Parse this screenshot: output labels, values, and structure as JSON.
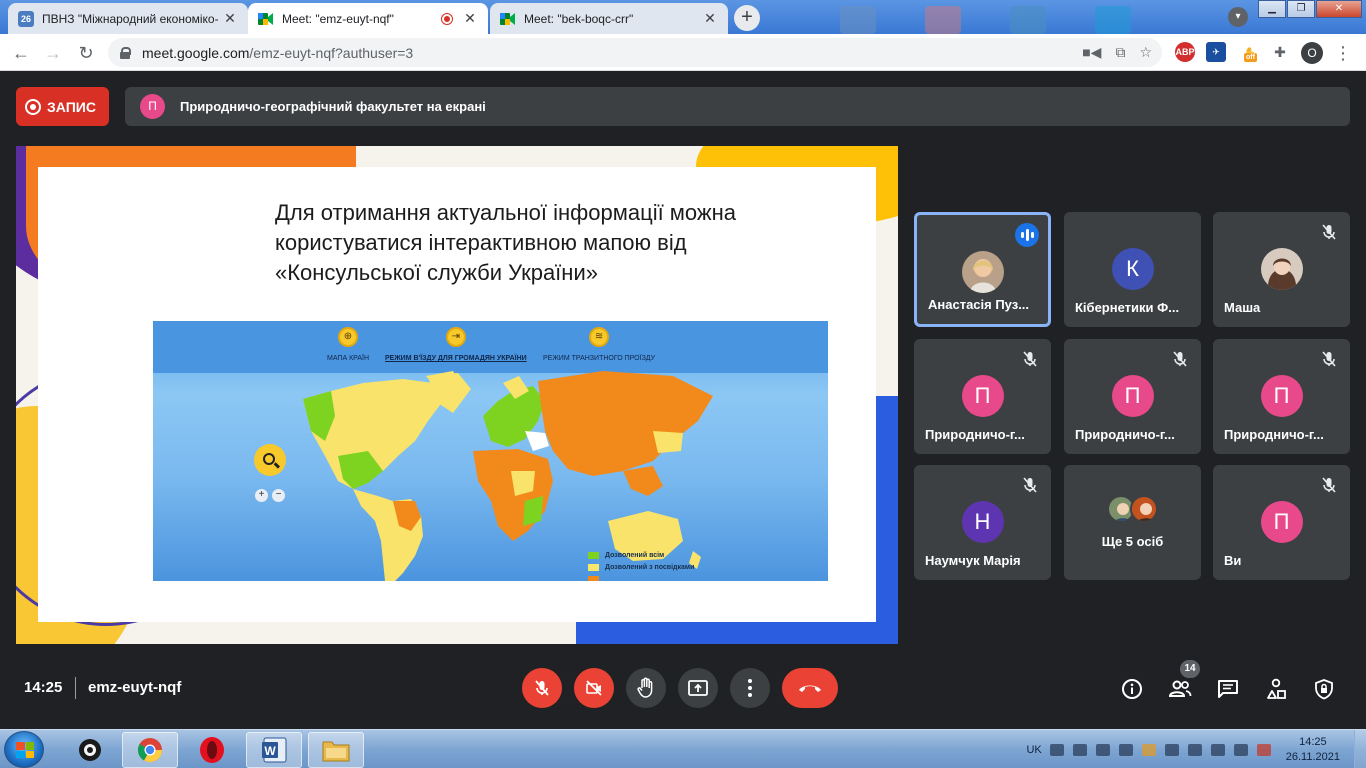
{
  "browser": {
    "tabs": [
      {
        "favicon_text": "26",
        "title": "ПВНЗ \"Міжнародний економіко-",
        "active": false
      },
      {
        "title": "Meet: \"emz-euyt-nqf\"",
        "active": true,
        "recording": true
      },
      {
        "title": "Meet: \"bek-boqc-crr\"",
        "active": false
      }
    ],
    "url_host": "meet.google.com",
    "url_path": "/emz-euyt-nqf?authuser=3",
    "extensions": {
      "abp": "ABP",
      "off_badge": "off"
    },
    "profile_initial": "O"
  },
  "meet": {
    "record_label": "ЗАПИС",
    "presenter_initial": "П",
    "presenting_text": "Природничо-географічний факультет на екрані",
    "slide": {
      "text": "Для отримання актуальної інформації можна користуватися інтерактивною мапою від «Консульської служби України»",
      "map": {
        "modes": [
          "МАПА КРАЇН",
          "РЕЖИМ В'ЇЗДУ ДЛЯ ГРОМАДЯН УКРАЇНИ",
          "РЕЖИМ ТРАНЗИТНОГО ПРОЇЗДУ"
        ],
        "legend": [
          {
            "label": "Дозволений всім",
            "color": "#7ed321"
          },
          {
            "label": "Дозволений з посвідками",
            "color": "#f8e76a"
          }
        ],
        "zoom_in": "+",
        "zoom_out": "−"
      }
    },
    "participants": [
      {
        "name": "Анастасія Пуз...",
        "type": "photo",
        "speaking": true
      },
      {
        "name": "Кібернетики Ф...",
        "initial": "К",
        "color": "#3f51b5",
        "muted": false
      },
      {
        "name": "Маша",
        "type": "photo2",
        "muted": true
      },
      {
        "name": "Природничо-г...",
        "initial": "П",
        "color": "#e8498b",
        "muted": true
      },
      {
        "name": "Природничо-г...",
        "initial": "П",
        "color": "#e8498b",
        "muted": true
      },
      {
        "name": "Природничо-г...",
        "initial": "П",
        "color": "#e8498b",
        "muted": true
      },
      {
        "name": "Наумчук Марія",
        "initial": "Н",
        "color": "#5e35b1",
        "muted": true
      },
      {
        "name": "Ще 5 осіб",
        "type": "group"
      },
      {
        "name": "Ви",
        "initial": "П",
        "color": "#e8498b",
        "muted": true
      }
    ],
    "time": "14:25",
    "meeting_code": "emz-euyt-nqf",
    "participant_count": "14"
  },
  "taskbar": {
    "lang": "UK",
    "time": "14:25",
    "date": "26.11.2021"
  }
}
